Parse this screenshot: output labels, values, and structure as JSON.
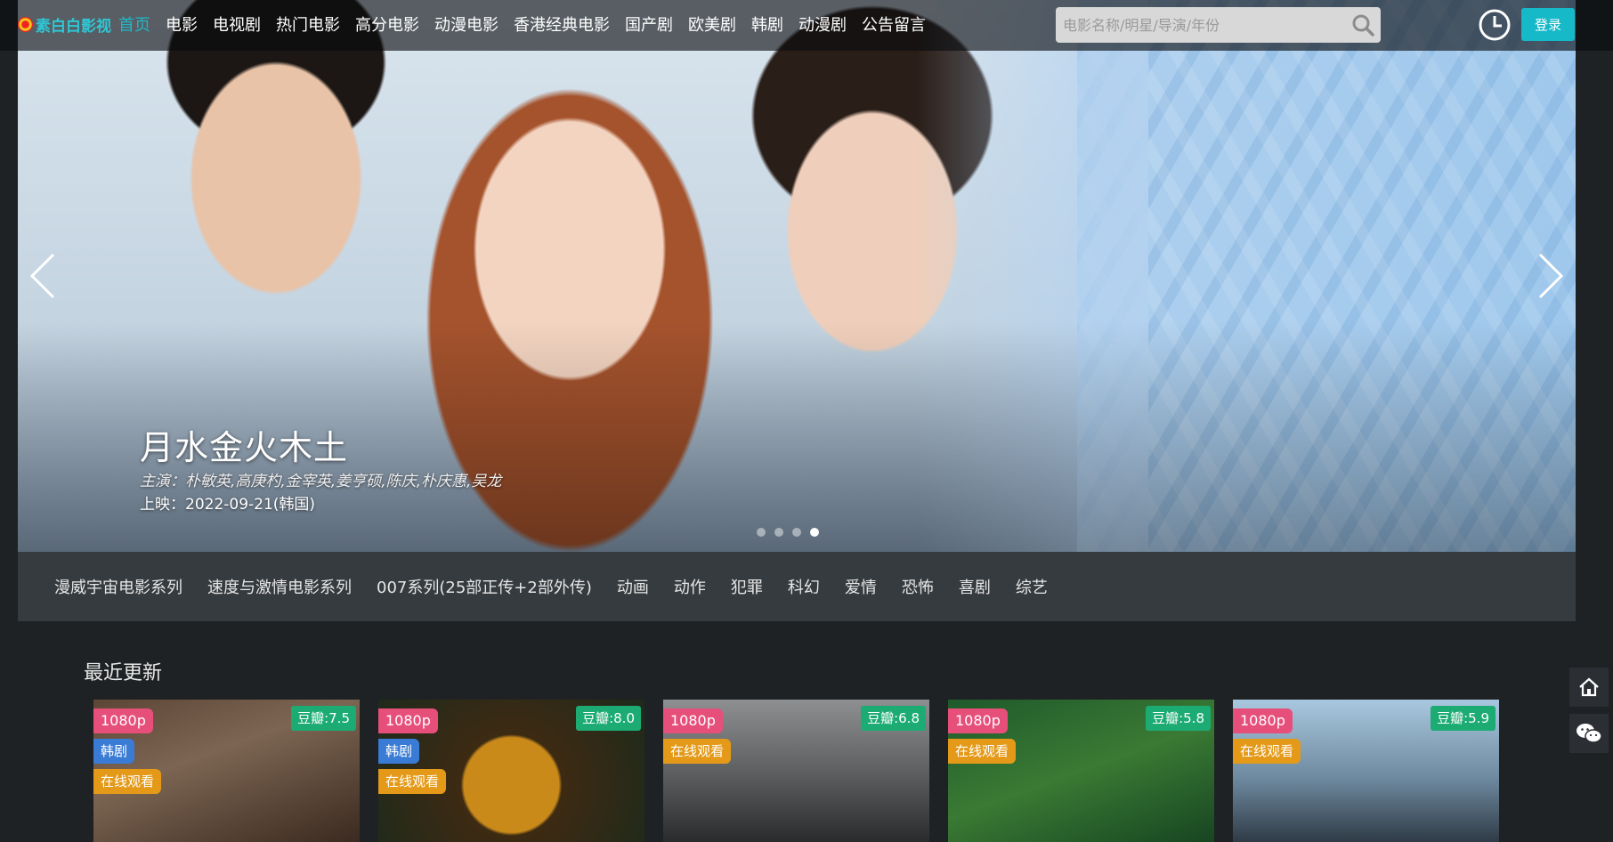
{
  "brand": {
    "name": "素白白影视"
  },
  "nav": {
    "items": [
      "首页",
      "电影",
      "电视剧",
      "热门电影",
      "高分电影",
      "动漫电影",
      "香港经典电影",
      "国产剧",
      "欧美剧",
      "韩剧",
      "动漫剧",
      "公告留言"
    ],
    "active_index": 0
  },
  "search": {
    "placeholder": "电影名称/明星/导演/年份",
    "value": ""
  },
  "header": {
    "login_label": "登录"
  },
  "banner": {
    "title": "月水金火木土",
    "cast": "主演：朴敏英,高庚杓,金宰英,姜亨硕,陈庆,朴庆惠,吴龙",
    "release": "上映：2022-09-21(韩国)",
    "slide_count": 4,
    "active_slide": 3
  },
  "categories": [
    "漫威宇宙电影系列",
    "速度与激情电影系列",
    "007系列(25部正传+2部外传)",
    "动画",
    "动作",
    "犯罪",
    "科幻",
    "爱情",
    "恐怖",
    "喜剧",
    "综艺"
  ],
  "recent": {
    "title": "最近更新",
    "cards": [
      {
        "res": "1080p",
        "type": "韩剧",
        "watch": "在线观看",
        "rating": "豆瓣:7.5"
      },
      {
        "res": "1080p",
        "type": "韩剧",
        "watch": "在线观看",
        "rating": "豆瓣:8.0"
      },
      {
        "res": "1080p",
        "watch": "在线观看",
        "rating": "豆瓣:6.8"
      },
      {
        "res": "1080p",
        "watch": "在线观看",
        "rating": "豆瓣:5.8"
      },
      {
        "res": "1080p",
        "watch": "在线观看",
        "rating": "豆瓣:5.9"
      }
    ]
  },
  "colors": {
    "accent": "#16b9c8",
    "nav_active": "#1fb8c9",
    "badge_res": "#e74f7b",
    "badge_type": "#3a7bd5",
    "badge_watch": "#e49a18",
    "badge_rating": "#1dab74"
  },
  "icons": {
    "search": "search-icon",
    "history": "clock-icon",
    "prev": "chevron-left-icon",
    "next": "chevron-right-icon",
    "home": "home-icon",
    "wechat": "wechat-icon"
  }
}
